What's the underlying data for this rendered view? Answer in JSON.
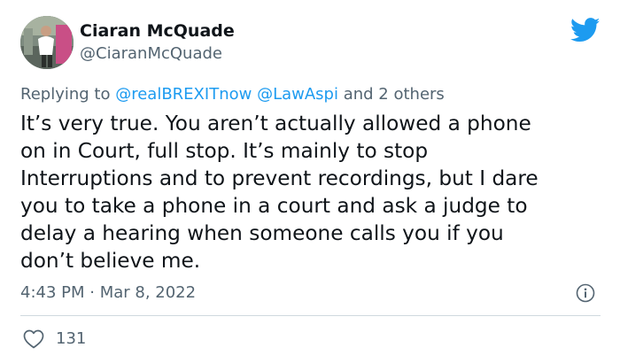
{
  "author": {
    "display_name": "Ciaran McQuade",
    "handle": "@CiaranMcQuade",
    "avatar_icon": "runner-photo-avatar"
  },
  "reply": {
    "prefix": "Replying to",
    "mention_1": "@realBREXITnow",
    "mention_2": "@LawAspi",
    "suffix": "and 2 others"
  },
  "tweet": {
    "lines": [
      "It’s very true. You aren’t actually allowed a phone",
      "on in Court, full stop. It’s mainly to stop",
      "Interruptions and to prevent recordings, but I dare",
      "you to take a phone in a court and ask a judge to",
      "delay a hearing when someone calls you if you",
      "don’t believe me."
    ]
  },
  "meta": {
    "timestamp": "4:43 PM · Mar 8, 2022",
    "likes": "131"
  },
  "icons": {
    "brand": "twitter-bird-icon",
    "info": "info-icon",
    "like": "heart-icon"
  },
  "colors": {
    "brand_blue": "#1d9bf0",
    "text_primary": "#0f1419",
    "text_secondary": "#536471",
    "divider": "#cfd9de"
  }
}
